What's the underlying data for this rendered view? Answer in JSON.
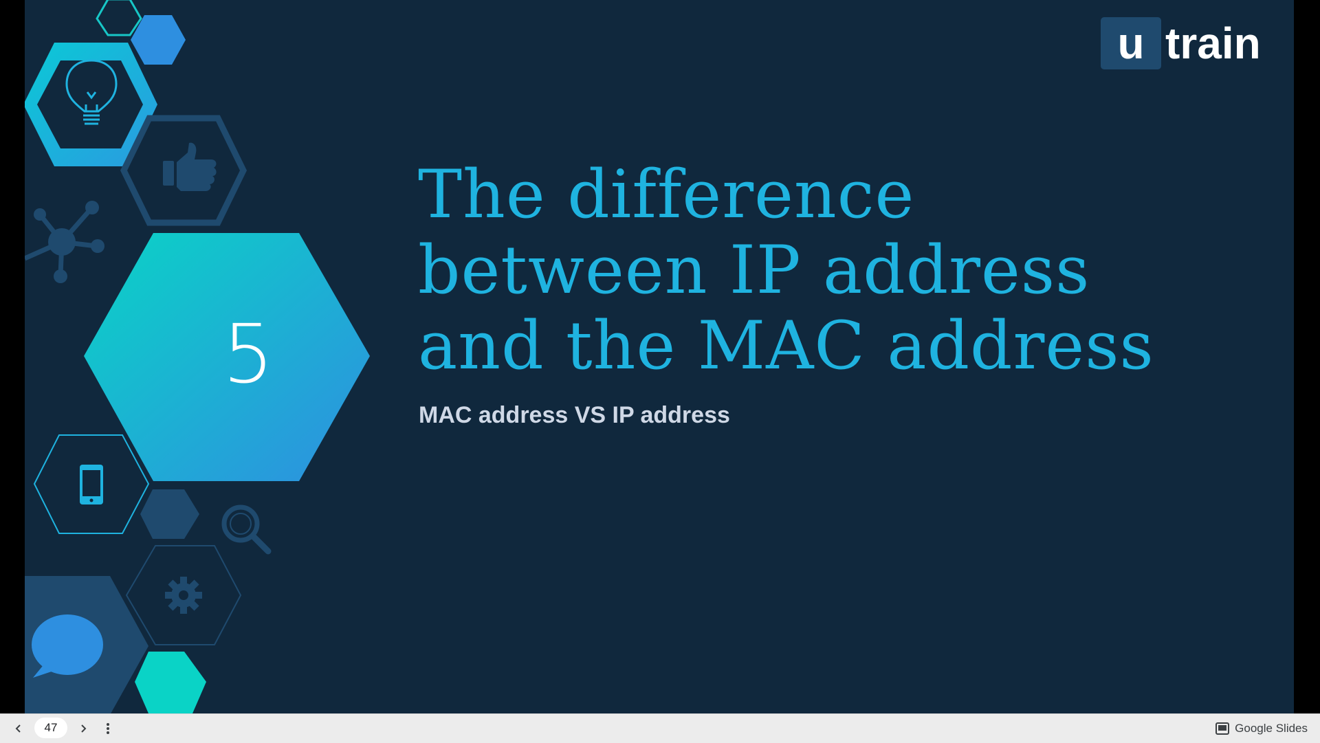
{
  "slide": {
    "section_number": "5",
    "title": "The difference between IP address and the MAC address",
    "subtitle": "MAC address VS IP address",
    "logo": {
      "box_letter": "u",
      "text": "train"
    },
    "colors": {
      "background": "#10283d",
      "title": "#1fb3e0",
      "subtitle": "#cfd8e6",
      "hex_teal": "#0ad3c6",
      "hex_blue": "#2e8fe0",
      "hex_dark": "#1f4a6e"
    },
    "decor_icons": [
      "lightbulb-icon",
      "thumbs-up-icon",
      "network-icon",
      "smartphone-icon",
      "search-icon",
      "gear-icon",
      "speech-bubble-icon"
    ]
  },
  "viewer": {
    "page_number": "47",
    "brand_label": "Google Slides",
    "prev_icon": "chevron-left-icon",
    "next_icon": "chevron-right-icon",
    "menu_icon": "more-vertical-icon"
  }
}
